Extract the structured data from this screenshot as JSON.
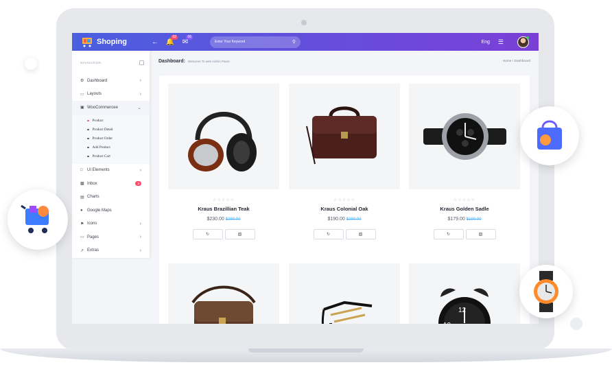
{
  "header": {
    "brand": "Shoping",
    "notification_count": "02",
    "message_count": "06",
    "search_placeholder": "Enter Your Keyword",
    "language": "Eng"
  },
  "sidebar": {
    "heading": "NAVIGATION",
    "items": [
      {
        "label": "Dashboard",
        "icon": "dashboard-icon"
      },
      {
        "label": "Layouts",
        "icon": "laptop-icon"
      },
      {
        "label": "WooCommercee",
        "icon": "cart-icon"
      },
      {
        "label": "UI Elements",
        "icon": "bookmark-icon"
      },
      {
        "label": "Inbox",
        "icon": "inbox-icon",
        "badge": "3"
      },
      {
        "label": "Charts",
        "icon": "chart-icon"
      },
      {
        "label": "Google Maps",
        "icon": "globe-icon"
      },
      {
        "label": "Icons",
        "icon": "flag-icon"
      },
      {
        "label": "Pages",
        "icon": "pages-icon"
      },
      {
        "label": "Extras",
        "icon": "external-link-icon"
      }
    ],
    "sub_items": [
      "Product",
      "Product Detail",
      "Product Order",
      "Add Product",
      "Product Cart"
    ]
  },
  "page": {
    "title": "Dashboard:",
    "subtitle": "Welcome To web Admin Panel",
    "breadcrumb_home": "Home",
    "breadcrumb_sep": "/",
    "breadcrumb_current": "Dashboard"
  },
  "products": [
    {
      "name": "Kraus Brazillian Teak",
      "price": "$230.00",
      "old_price": "$290.00",
      "stars": "☆☆☆☆☆"
    },
    {
      "name": "Kraus Colonial Oak",
      "price": "$190.00",
      "old_price": "$290.00",
      "stars": "☆☆☆☆☆"
    },
    {
      "name": "Kraus Golden Sadle",
      "price": "$179.00",
      "old_price": "$190.00",
      "stars": "☆☆☆☆☆"
    }
  ],
  "colors": {
    "header_start": "#4b5fe0",
    "header_end": "#7b3fd6",
    "accent_badge": "#ff4d6d",
    "old_price": "#4fb3ff"
  }
}
